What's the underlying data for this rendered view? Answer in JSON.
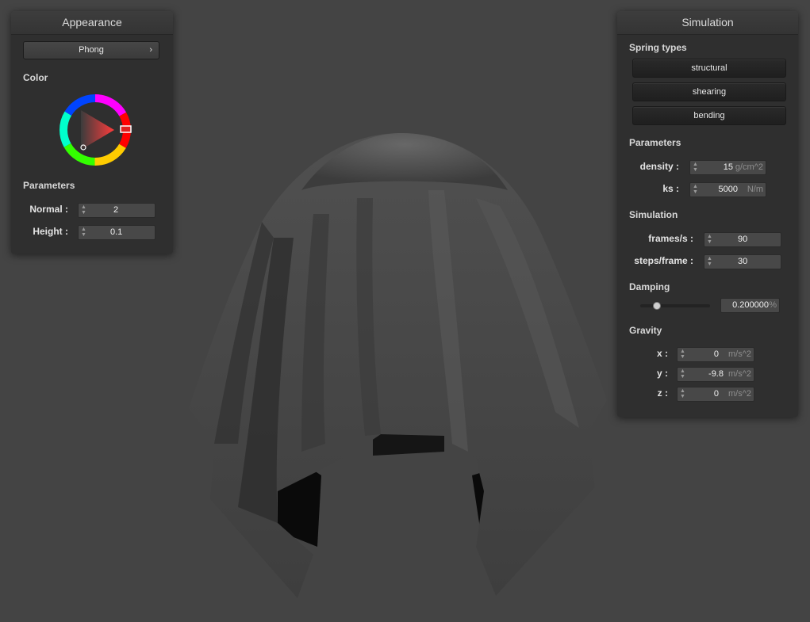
{
  "appearance": {
    "title": "Appearance",
    "shader": "Phong",
    "color_label": "Color",
    "parameters_label": "Parameters",
    "normal_label": "Normal :",
    "normal_value": "2",
    "height_label": "Height :",
    "height_value": "0.1",
    "selected_color": "#ff1a1a"
  },
  "simulation": {
    "title": "Simulation",
    "spring_types_label": "Spring types",
    "springs": [
      "structural",
      "shearing",
      "bending"
    ],
    "parameters_label": "Parameters",
    "density_label": "density :",
    "density_value": "15",
    "density_unit": "g/cm^2",
    "ks_label": "ks :",
    "ks_value": "5000",
    "ks_unit": "N/m",
    "simulation_label": "Simulation",
    "fps_label": "frames/s :",
    "fps_value": "90",
    "steps_label": "steps/frame :",
    "steps_value": "30",
    "damping_label": "Damping",
    "damping_value": "0.200000",
    "damping_unit": "%",
    "damping_fraction": 0.2,
    "gravity_label": "Gravity",
    "gx_label": "x :",
    "gx_value": "0",
    "gx_unit": "m/s^2",
    "gy_label": "y :",
    "gy_value": "-9.8",
    "gy_unit": "m/s^2",
    "gz_label": "z :",
    "gz_value": "0",
    "gz_unit": "m/s^2"
  },
  "colors": {
    "background": "#444444",
    "panel": "#2f2f2f",
    "cloth": "#5a5a5a"
  }
}
